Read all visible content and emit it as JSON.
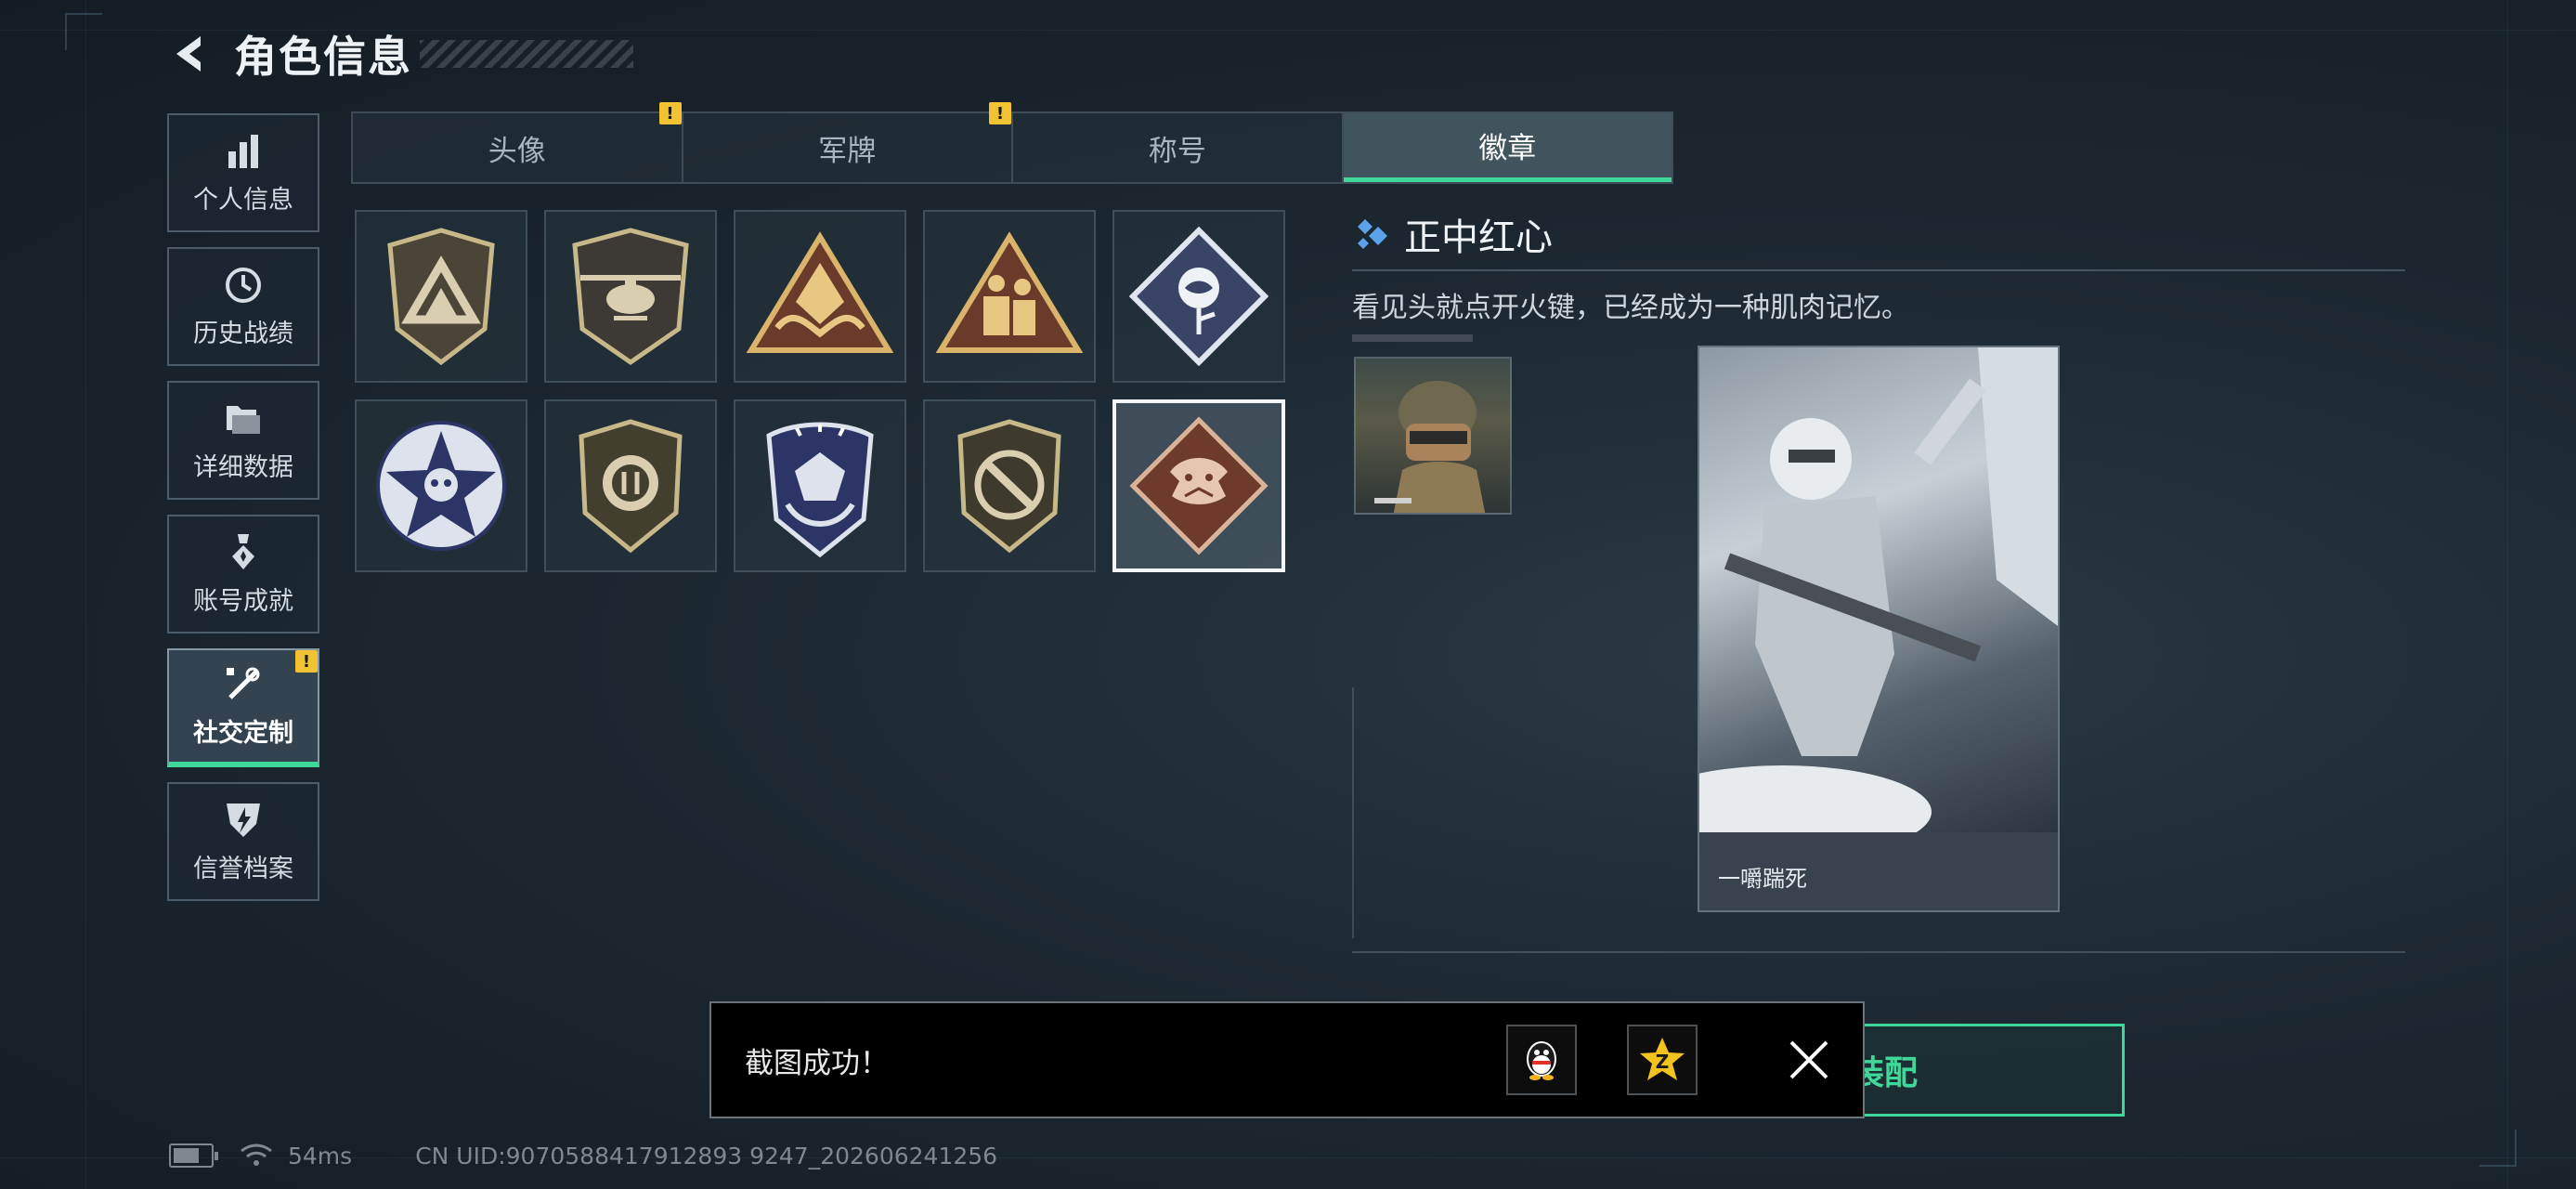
{
  "header": {
    "title": "角色信息"
  },
  "sidebar": {
    "items": [
      {
        "label": "个人信息",
        "icon": "bar-chart-icon",
        "active": false,
        "alert": false
      },
      {
        "label": "历史战绩",
        "icon": "clock-icon",
        "active": false,
        "alert": false
      },
      {
        "label": "详细数据",
        "icon": "folder-icon",
        "active": false,
        "alert": false
      },
      {
        "label": "账号成就",
        "icon": "medal-icon",
        "active": false,
        "alert": false
      },
      {
        "label": "社交定制",
        "icon": "tools-icon",
        "active": true,
        "alert": true
      },
      {
        "label": "信誉档案",
        "icon": "shield-bolt-icon",
        "active": false,
        "alert": false
      }
    ]
  },
  "tabs": [
    {
      "label": "头像",
      "alert": true,
      "active": false
    },
    {
      "label": "军牌",
      "alert": true,
      "active": false
    },
    {
      "label": "称号",
      "alert": false,
      "active": false
    },
    {
      "label": "徽章",
      "alert": false,
      "active": true
    }
  ],
  "badges": [
    {
      "name": "triangle-shield-badge",
      "selected": false
    },
    {
      "name": "helicopter-shield-badge",
      "selected": false
    },
    {
      "name": "gem-triangle-badge",
      "selected": false
    },
    {
      "name": "soldiers-triangle-badge",
      "selected": false
    },
    {
      "name": "rose-diamond-badge",
      "selected": false
    },
    {
      "name": "star-skull-badge",
      "selected": false
    },
    {
      "name": "round-shield-badge",
      "selected": false
    },
    {
      "name": "crystal-wreath-badge",
      "selected": false
    },
    {
      "name": "knife-shield-badge",
      "selected": false
    },
    {
      "name": "dragon-diamond-badge",
      "selected": true
    }
  ],
  "detail": {
    "name": "正中红心",
    "description": "看见头就点开火键，已经成为一种肌肉记忆。",
    "card_label": "一嚼踹死"
  },
  "equip_button": {
    "label": "装配"
  },
  "toast": {
    "message": "截图成功！",
    "share_qq": "qq-share-icon",
    "share_qzone": "qzone-share-icon"
  },
  "status": {
    "ping": "54ms",
    "uid": "CN UID:9070588417912893 9247_202606241256"
  },
  "colors": {
    "accent": "#3fd79a",
    "alert": "#f1c232",
    "toast_bg": "#000000"
  }
}
